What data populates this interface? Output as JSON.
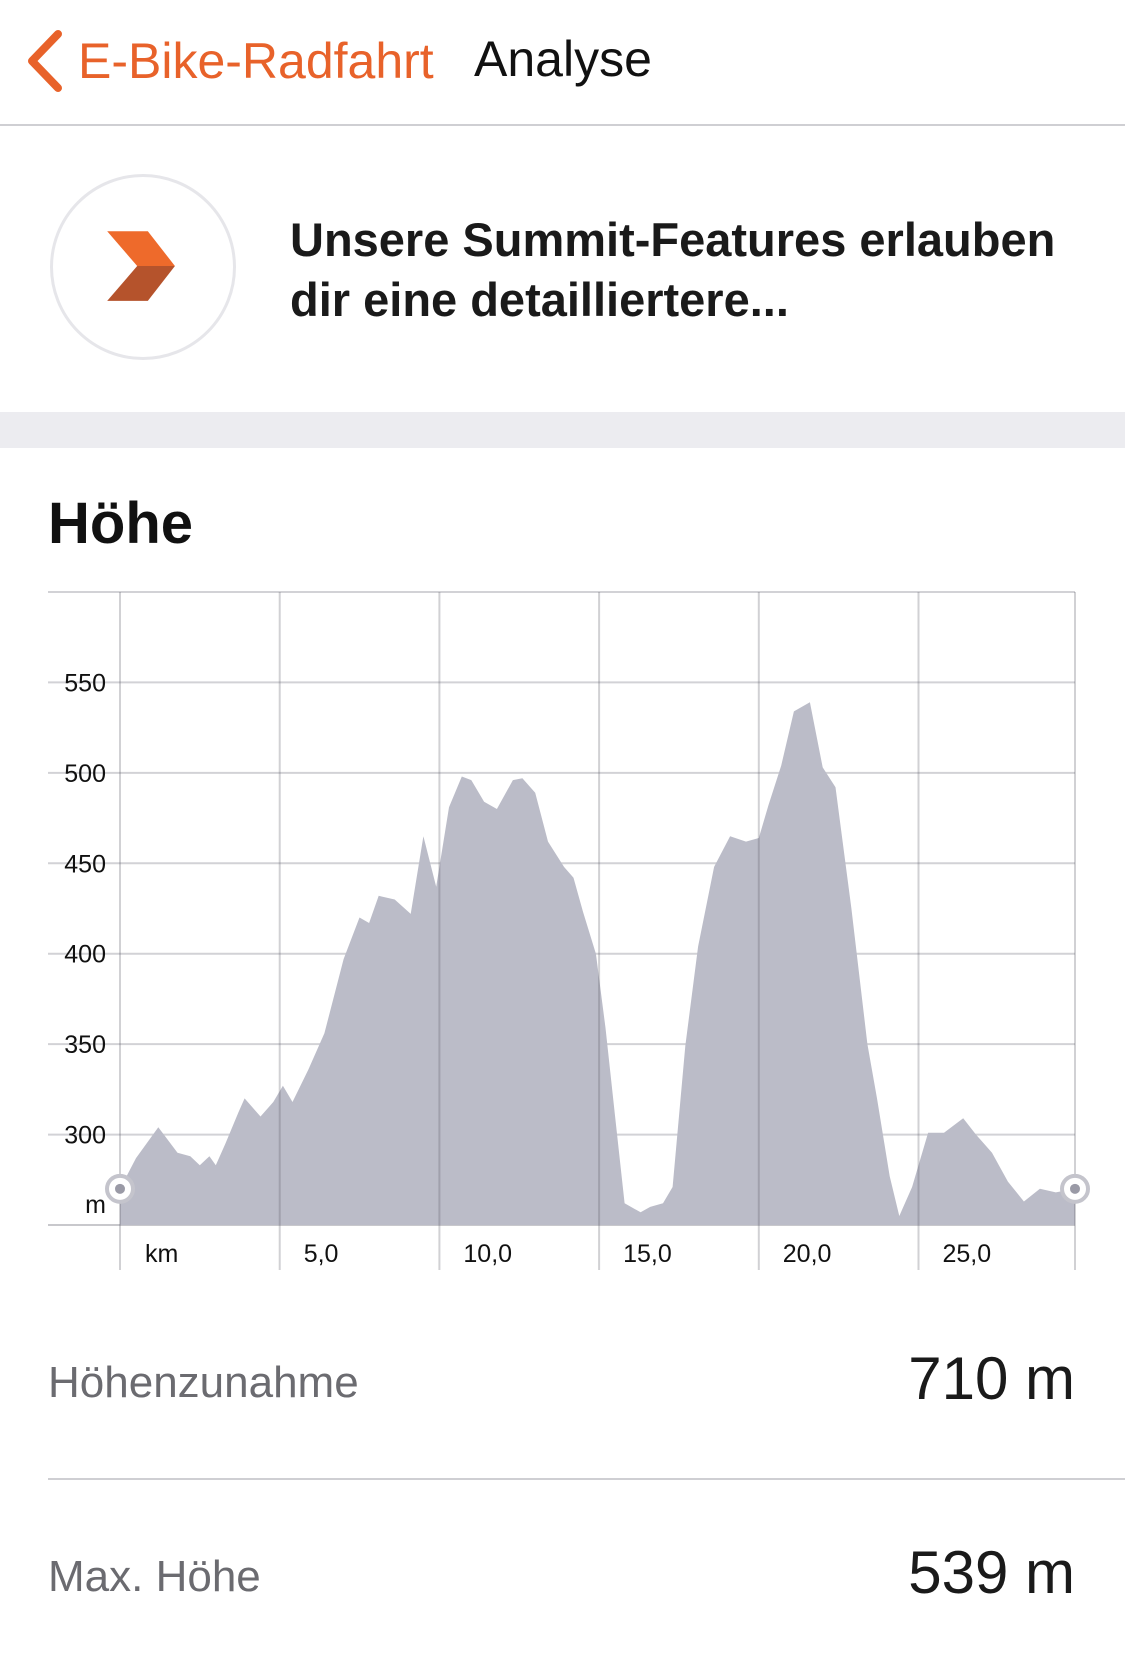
{
  "nav": {
    "back_label": "E-Bike-Radfahrt",
    "title": "Analyse",
    "accent_color": "#e8622a"
  },
  "promo": {
    "text": "Unsere Summit-Features erlauben dir eine detailliertere...",
    "icon": "strava-summit-chevron-icon"
  },
  "section": {
    "title": "Höhe"
  },
  "stats": [
    {
      "label": "Höhenzunahme",
      "value": "710 m"
    },
    {
      "label": "Max. Höhe",
      "value": "539 m"
    }
  ],
  "chart_data": {
    "type": "area",
    "title": "Höhe",
    "x_unit_label": "km",
    "y_unit_label": "m",
    "x_tick_labels": [
      "5,0",
      "10,0",
      "15,0",
      "20,0",
      "25,0"
    ],
    "x_ticks": [
      5,
      10,
      15,
      20,
      25
    ],
    "y_ticks": [
      300,
      350,
      400,
      450,
      500,
      550
    ],
    "xlim": [
      0,
      29.9
    ],
    "ylim": [
      250,
      600
    ],
    "grid": true,
    "fill_color": "#bbbcc8",
    "x": [
      0,
      0.5,
      1.2,
      1.8,
      2.2,
      2.5,
      2.8,
      3.0,
      3.3,
      3.7,
      3.9,
      4.4,
      4.8,
      5.1,
      5.4,
      5.9,
      6.4,
      7.0,
      7.5,
      7.8,
      8.1,
      8.6,
      9.1,
      9.5,
      9.9,
      10.3,
      10.7,
      11.0,
      11.4,
      11.8,
      12.3,
      12.6,
      13.0,
      13.4,
      13.9,
      14.2,
      14.5,
      14.9,
      15.2,
      15.5,
      15.8,
      16.3,
      16.6,
      17.0,
      17.3,
      17.7,
      18.1,
      18.6,
      19.1,
      19.6,
      20.0,
      20.3,
      20.7,
      21.1,
      21.6,
      22.0,
      22.4,
      22.9,
      23.4,
      23.7,
      24.1,
      24.4,
      24.8,
      25.3,
      25.8,
      26.1,
      26.4,
      26.8,
      27.3,
      27.8,
      28.3,
      28.8,
      29.3,
      29.9
    ],
    "y": [
      270,
      287,
      304,
      290,
      288,
      283,
      288,
      283,
      295,
      312,
      320,
      310,
      318,
      327,
      318,
      336,
      356,
      397,
      420,
      417,
      432,
      430,
      422,
      465,
      437,
      481,
      498,
      496,
      484,
      480,
      496,
      497,
      489,
      462,
      448,
      442,
      423,
      400,
      359,
      310,
      262,
      257,
      260,
      262,
      271,
      349,
      404,
      448,
      465,
      462,
      464,
      482,
      504,
      534,
      539,
      503,
      492,
      425,
      350,
      320,
      277,
      255,
      271,
      301,
      301,
      305,
      309,
      300,
      290,
      274,
      263,
      270,
      268,
      270
    ]
  }
}
